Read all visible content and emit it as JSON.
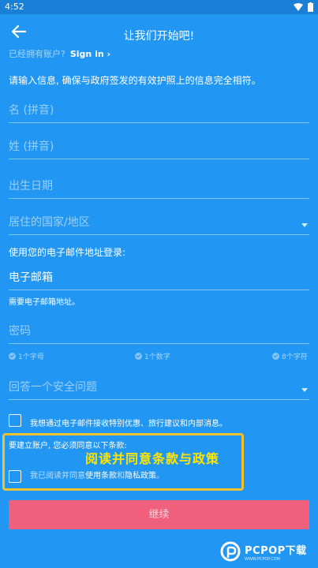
{
  "status": {
    "time": "4:52"
  },
  "header": {
    "title": "让我们开始吧!"
  },
  "signin": {
    "prompt": "已经拥有账户?",
    "link": "Sign in",
    "chevron": "›"
  },
  "intro": "请输入信息, 确保与政府签发的有效护照上的信息完全相符。",
  "fields": {
    "first_name": {
      "placeholder": "名 (拼音)"
    },
    "last_name": {
      "placeholder": "姓 (拼音)"
    },
    "dob": {
      "placeholder": "出生日期"
    },
    "country": {
      "placeholder": "居住的国家/地区"
    },
    "email_prompt": "使用您的电子邮件地址登录:",
    "email": {
      "value": "电子邮箱",
      "help": "需要电子邮箱地址。"
    },
    "password": {
      "placeholder": "密码"
    },
    "security": {
      "placeholder": "回答一个安全问题"
    }
  },
  "password_rules": [
    "1个字母",
    "1个数字",
    "8个字符"
  ],
  "marketing": {
    "label": "我想通过电子邮件接收特别优惠、旅行建议和内部消息。"
  },
  "terms": {
    "title": "要建立账户, 您必须同意以下条款:",
    "agree_prefix": "我已阅读并同意",
    "terms_link": "使用条款",
    "and": "和",
    "privacy_link": "隐私政策",
    "suffix": "。"
  },
  "annotation": "阅读并同意条款与政策",
  "continue_label": "继续",
  "watermark": {
    "brand": "PCPOP下载",
    "sub": "WWW.PCPOP.COM"
  },
  "colors": {
    "background": "#2196f3",
    "button": "#f0607c",
    "highlight": "#f2c12e",
    "annotation": "#ffe500"
  }
}
